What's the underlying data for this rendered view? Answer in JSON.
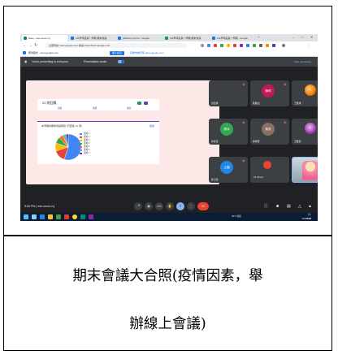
{
  "browser": {
    "tabs": [
      {
        "label": "Meet - ese-wouu-rvj",
        "color": "#00897b"
      },
      {
        "label": "111學年度第一學期 期末會議",
        "color": "#1a73e8"
      },
      {
        "label": "(Wsuvin) Dr.me - Google",
        "color": "#1a73e8"
      },
      {
        "label": "111學年度第一學期 期末會議",
        "color": "#0f9d58"
      },
      {
        "label": "111學年度第一學期 - Google",
        "color": "#1a73e8"
      }
    ],
    "url": "立即發言 meet.google.com 會議 https://docs.google.com",
    "bookmarks": [
      "應用程式",
      "meet.google.com",
      "個人設定",
      "基隆市教育局 docs.google.com"
    ],
    "colors": {
      "tabbar": "#dee1e6",
      "accent": "#1a73e8"
    }
  },
  "presenting": {
    "label": "You're presenting to everyone",
    "audio_label": "Presentation audio",
    "stop_label": "Stop presenting"
  },
  "form": {
    "title": "22 則回應",
    "tabs": [
      "摘要",
      "問題",
      "個別"
    ],
    "question": "本學期的期末會議時間 (已回答 22 項)",
    "link": "複製",
    "chart_data": {
      "type": "pie",
      "values": [
        55,
        15,
        10,
        8,
        5,
        4,
        3
      ],
      "colors": [
        "#4285f4",
        "#ea4335",
        "#fbbc04",
        "#34a853",
        "#ff6d01",
        "#46bdc6",
        "#7b1fa2"
      ]
    },
    "legend": [
      "選項 1",
      "選項 2",
      "選項 3",
      "選項 4",
      "選項 5",
      "選項 6",
      "選項 7"
    ]
  },
  "participants": [
    {
      "name": "吳佳琪",
      "avatar": "",
      "avatar_color": "#5f6368",
      "kind": "none"
    },
    {
      "name": "陳雅如",
      "avatar": "陳明",
      "avatar_color": "#c2185b",
      "kind": "initials"
    },
    {
      "name": "王雅琪",
      "avatar": "",
      "avatar_color": "#f57c00",
      "kind": "photo"
    },
    {
      "name": "林淑華",
      "avatar": "張冰",
      "avatar_color": "#33a852",
      "kind": "initials"
    },
    {
      "name": "林佩蓉",
      "avatar": "謝潔",
      "avatar_color": "#8d6e63",
      "kind": "initials"
    },
    {
      "name": "王雅慧",
      "avatar": "",
      "avatar_color": "#ab47bc",
      "kind": "photo"
    },
    {
      "name": "黃士勤",
      "avatar": "土國",
      "avatar_color": "#1e88e5",
      "kind": "initials"
    },
    {
      "name": "",
      "avatar": "",
      "avatar_color": "#ea4335",
      "kind": "others",
      "others_label": "13 others"
    },
    {
      "name": "",
      "avatar": "",
      "avatar_color": "#bcaaa4",
      "kind": "self"
    }
  ],
  "bottom": {
    "time": "5:06 PM",
    "code": "ese-wouu-rvj",
    "controls": [
      "mic-icon",
      "camera-icon",
      "captions-icon",
      "raise-hand-icon",
      "present-icon",
      "more-icon",
      "end-call-icon"
    ],
    "end_color": "#ea4335"
  },
  "taskbar": {
    "clock": "下午 05:06",
    "date": "2022/6/30",
    "weather": "28°C 晴朗"
  },
  "caption": {
    "line1": "期末會議大合照(疫情因素，舉",
    "line2": "辦線上會議)"
  }
}
